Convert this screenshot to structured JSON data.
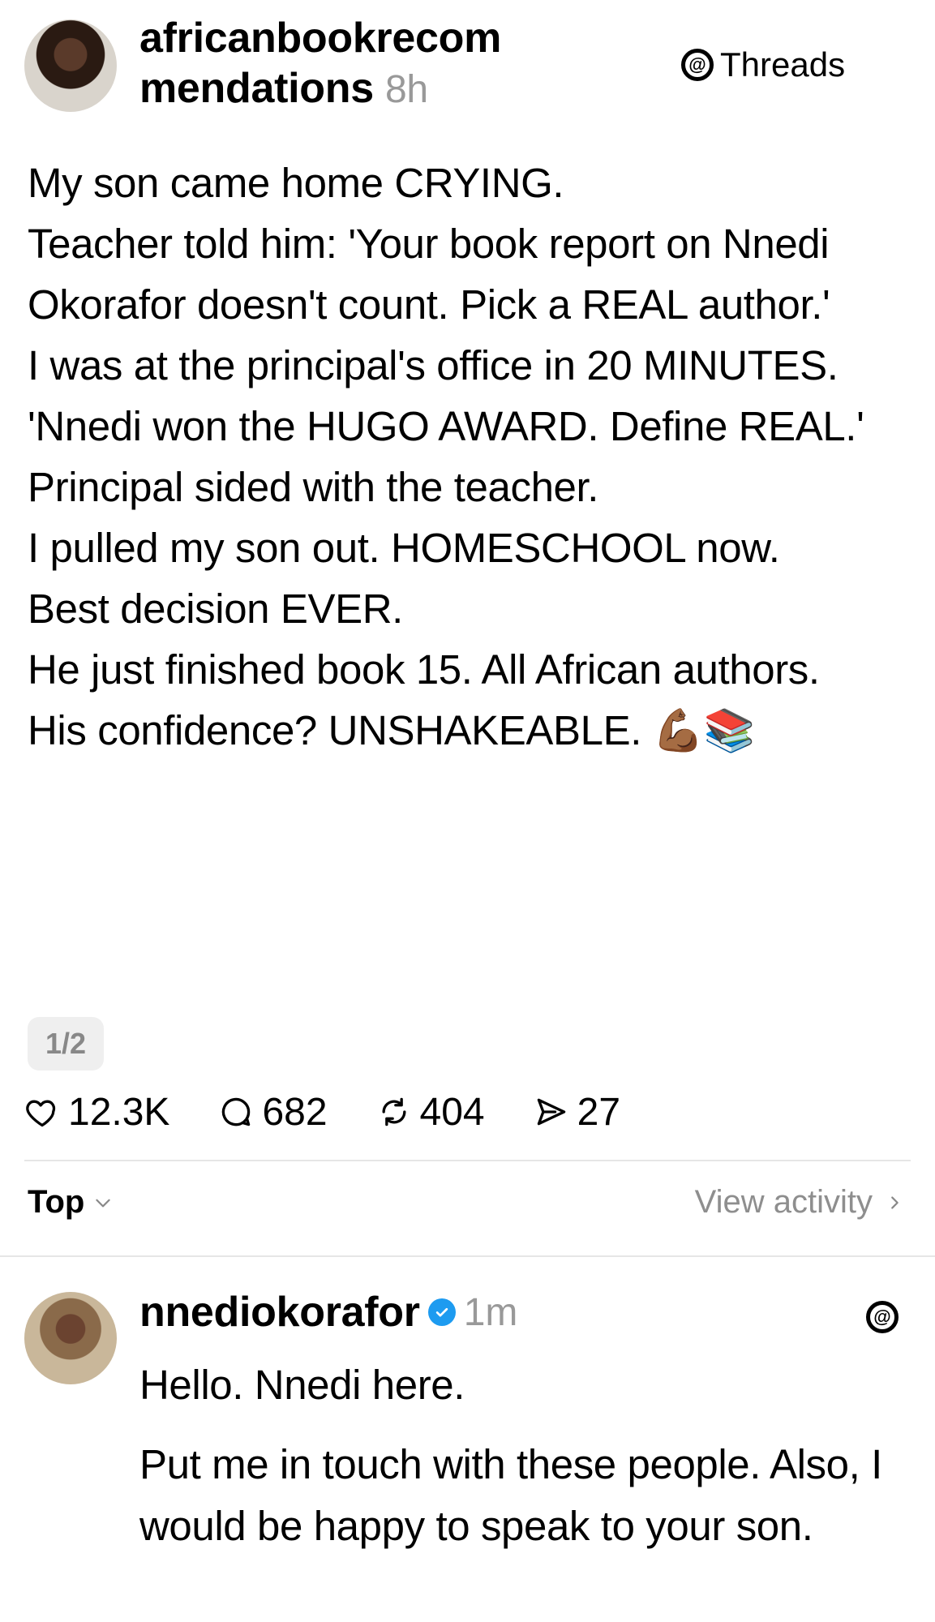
{
  "post": {
    "username": "africanbookrecommendations",
    "username_line1": "africanbookrecom",
    "username_line2": "mendations",
    "time": "8h",
    "badge_label": "Threads",
    "lines": [
      "My son came home CRYING.",
      "Teacher told him: 'Your book report on Nnedi Okorafor doesn't count. Pick a REAL author.'",
      "I was at the principal's office in 20 MINUTES.",
      "'Nnedi won the HUGO AWARD. Define REAL.'",
      "Principal sided with the teacher.",
      "I pulled my son out. HOMESCHOOL now.",
      "Best decision EVER.",
      "He just finished book 15. All African authors.",
      "His confidence? UNSHAKEABLE. 💪🏾📚"
    ],
    "pager": "1/2",
    "likes": "12.3K",
    "replies": "682",
    "reposts": "404",
    "shares": "27"
  },
  "sort": {
    "label": "Top",
    "view_activity": "View activity"
  },
  "reply": {
    "username": "nnediokorafor",
    "time": "1m",
    "paragraphs": [
      "Hello. Nnedi here.",
      "Put me in touch with these people. Also, I would be happy to speak to your son."
    ]
  },
  "icons": {
    "like": "heart-icon",
    "reply": "comment-icon",
    "repost": "repost-icon",
    "share": "share-icon",
    "verified": "verified-badge-icon",
    "threads": "threads-logo-icon"
  },
  "colors": {
    "muted": "#999999",
    "verified": "#1d9bf0",
    "divider": "#e6e6e6"
  }
}
